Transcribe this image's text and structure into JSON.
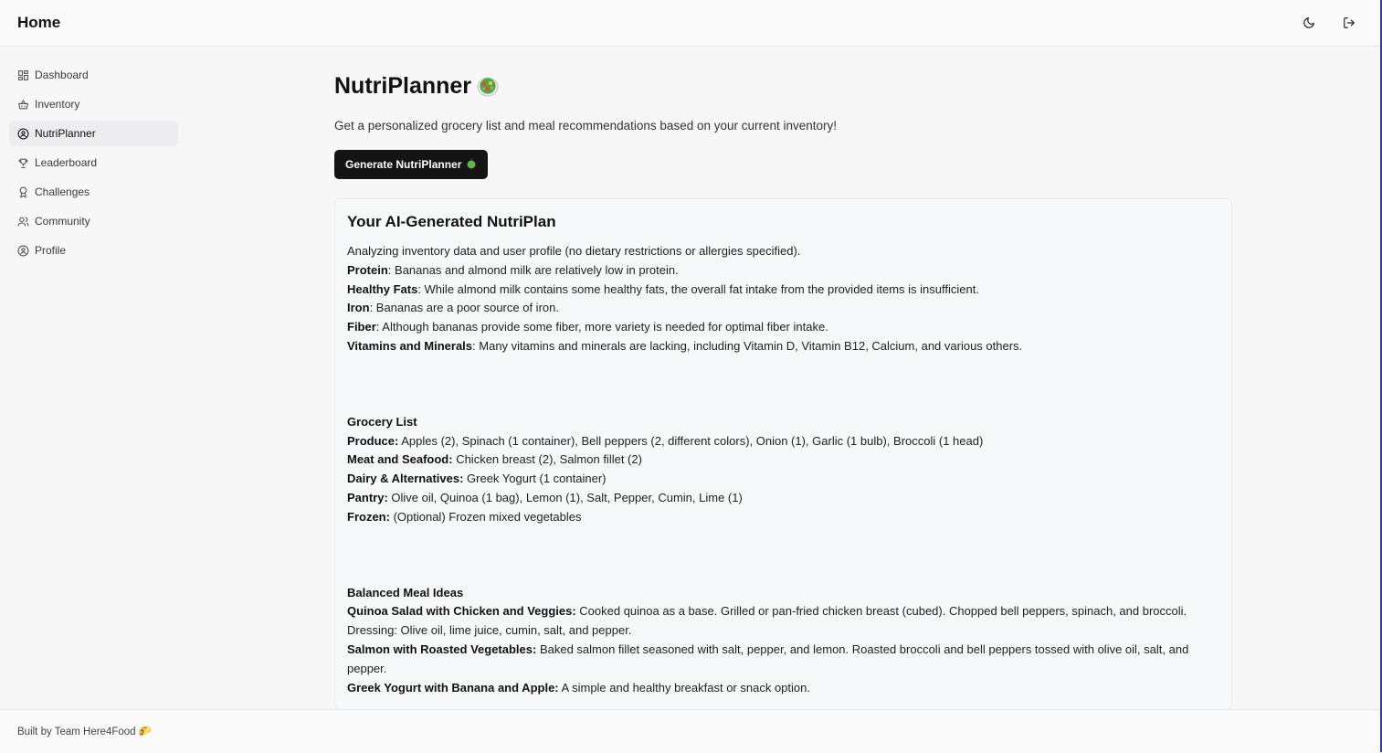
{
  "header": {
    "title": "Home"
  },
  "sidebar": {
    "items": [
      {
        "label": "Dashboard",
        "icon": "dashboard-icon",
        "active": false
      },
      {
        "label": "Inventory",
        "icon": "basket-icon",
        "active": false
      },
      {
        "label": "NutriPlanner",
        "icon": "user-circle-icon",
        "active": true
      },
      {
        "label": "Leaderboard",
        "icon": "trophy-icon",
        "active": false
      },
      {
        "label": "Challenges",
        "icon": "award-icon",
        "active": false
      },
      {
        "label": "Community",
        "icon": "users-icon",
        "active": false
      },
      {
        "label": "Profile",
        "icon": "profile-circle-icon",
        "active": false
      }
    ]
  },
  "main": {
    "title": "NutriPlanner",
    "subtitle": "Get a personalized grocery list and meal recommendations based on your current inventory!",
    "generate_label": "Generate NutriPlanner"
  },
  "plan": {
    "title": "Your AI-Generated NutriPlan",
    "intro": "Analyzing inventory data and user profile (no dietary restrictions or allergies specified).",
    "nutrients": [
      {
        "label": "Protein",
        "text": ": Bananas and almond milk are relatively low in protein."
      },
      {
        "label": "Healthy Fats",
        "text": ": While almond milk contains some healthy fats, the overall fat intake from the provided items is insufficient."
      },
      {
        "label": "Iron",
        "text": ": Bananas are a poor source of iron."
      },
      {
        "label": "Fiber",
        "text": ": Although bananas provide some fiber, more variety is needed for optimal fiber intake."
      },
      {
        "label": "Vitamins and Minerals",
        "text": ": Many vitamins and minerals are lacking, including Vitamin D, Vitamin B12, Calcium, and various others."
      }
    ],
    "grocery_heading": "Grocery List",
    "grocery": [
      {
        "label": "Produce:",
        "text": " Apples (2), Spinach (1 container), Bell peppers (2, different colors), Onion (1), Garlic (1 bulb), Broccoli (1 head)"
      },
      {
        "label": "Meat and Seafood:",
        "text": " Chicken breast (2), Salmon fillet (2)"
      },
      {
        "label": "Dairy & Alternatives:",
        "text": " Greek Yogurt (1 container)"
      },
      {
        "label": "Pantry:",
        "text": " Olive oil, Quinoa (1 bag), Lemon (1), Salt, Pepper, Cumin, Lime (1)"
      },
      {
        "label": "Frozen:",
        "text": " (Optional) Frozen mixed vegetables"
      }
    ],
    "meals_heading": "Balanced Meal Ideas",
    "meals": [
      {
        "label": "Quinoa Salad with Chicken and Veggies:",
        "text": " Cooked quinoa as a base. Grilled or pan-fried chicken breast (cubed). Chopped bell peppers, spinach, and broccoli. Dressing: Olive oil, lime juice, cumin, salt, and pepper."
      },
      {
        "label": "Salmon with Roasted Vegetables:",
        "text": " Baked salmon fillet seasoned with salt, pepper, and lemon. Roasted broccoli and bell peppers tossed with olive oil, salt, and pepper."
      },
      {
        "label": "Greek Yogurt with Banana and Apple:",
        "text": " A simple and healthy breakfast or snack option."
      }
    ]
  },
  "footer": {
    "text": "Built by Team Here4Food 🌮"
  },
  "colors": {
    "accent": "#141414",
    "edge": "#2f3bb5",
    "active_bg": "#ededf0"
  }
}
